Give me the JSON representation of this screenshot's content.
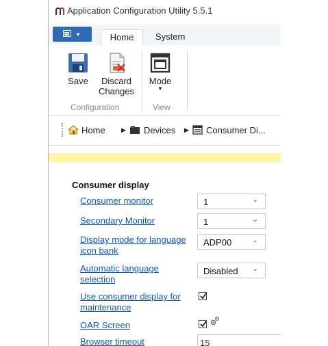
{
  "window": {
    "title": "Application Configuration Utility 5.5.1"
  },
  "tabs": {
    "home": "Home",
    "system": "System"
  },
  "ribbon": {
    "save_label": "Save",
    "discard_label_1": "Discard",
    "discard_label_2": "Changes",
    "mode_label": "Mode",
    "group_configuration": "Configuration",
    "group_view": "View"
  },
  "breadcrumb": {
    "home": "Home",
    "devices": "Devices",
    "consumer": "Consumer Di..."
  },
  "section": {
    "title": "Consumer display"
  },
  "settings": {
    "consumer_monitor": {
      "label": "Consumer monitor",
      "value": "1"
    },
    "secondary_monitor": {
      "label": "Secondary Monitor",
      "value": "1"
    },
    "display_mode": {
      "label": "Display mode for language icon bank",
      "value": "ADP00"
    },
    "auto_language": {
      "label": "Automatic language selection",
      "value": "Disabled"
    },
    "use_consumer_display": {
      "label": "Use consumer display for maintenance",
      "checked": true
    },
    "oar_screen": {
      "label": "OAR Screen",
      "checked": true
    },
    "browser_timeout": {
      "label": "Browser timeout",
      "value": "15"
    }
  },
  "colors": {
    "accent": "#2d6bb5",
    "link": "#0b57c2",
    "notice": "#fdf6a0"
  }
}
